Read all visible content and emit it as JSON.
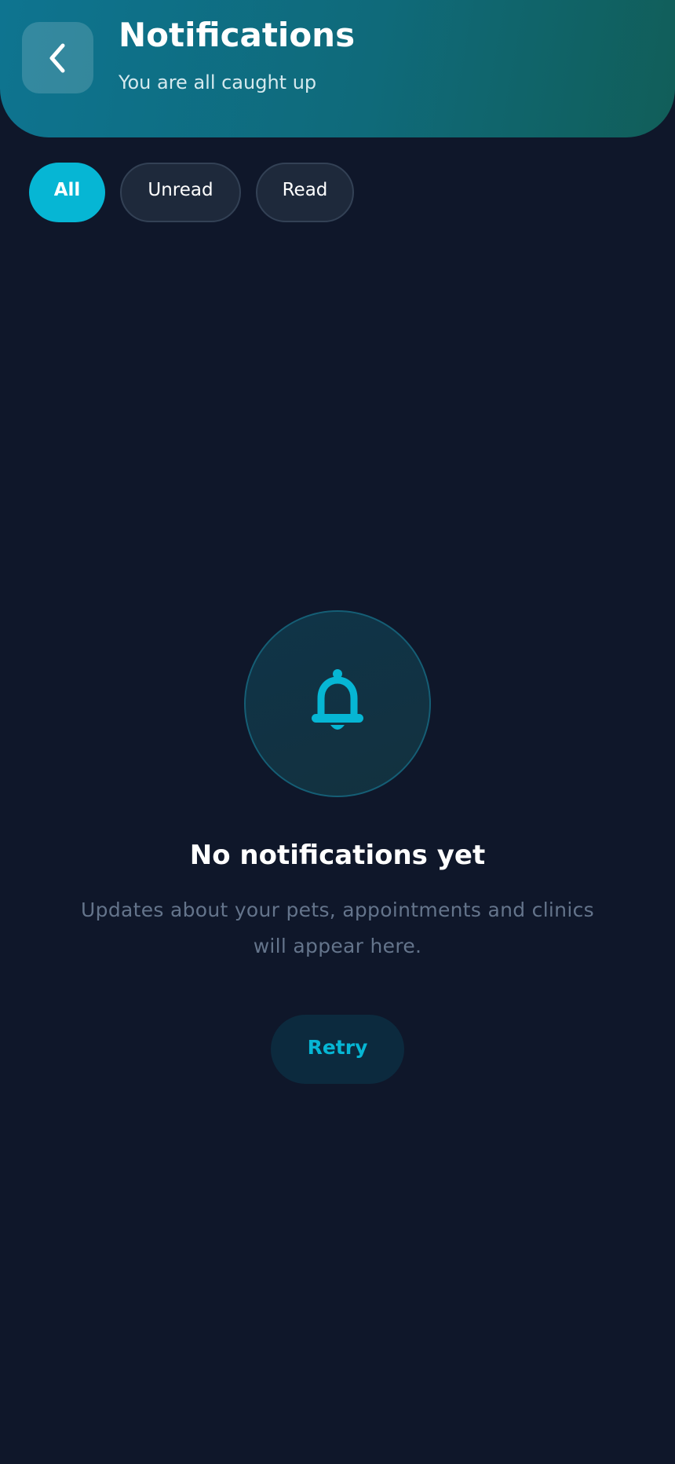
{
  "header": {
    "title": "Notifications",
    "subtitle": "You are all caught up",
    "back_icon": "chevron-left-icon"
  },
  "filters": {
    "items": [
      {
        "label": "All",
        "active": true
      },
      {
        "label": "Unread",
        "active": false
      },
      {
        "label": "Read",
        "active": false
      }
    ]
  },
  "empty_state": {
    "icon": "bell-icon",
    "title": "No notifications yet",
    "description": "Updates about your pets, appointments and clinics will appear here.",
    "retry_label": "Retry"
  },
  "colors": {
    "background": "#0f172a",
    "accent": "#06b6d4",
    "header_gradient_start": "#0e7490",
    "header_gradient_end": "#115e59"
  }
}
